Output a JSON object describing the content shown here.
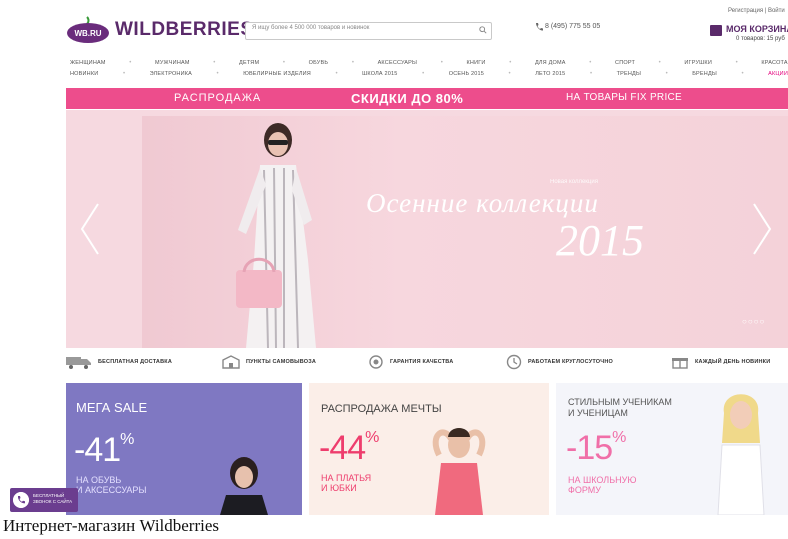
{
  "header": {
    "logo_badge": "WB.RU",
    "logo_text": "WILDBERRIES",
    "search_placeholder": "Я ищу более 4 500 000 товаров и новинок",
    "phone": "8 (495) 775 55 05",
    "top_links": "Регистрация | Войти",
    "cart_label": "МОЯ КОРЗИНА",
    "cart_summary": "0 товаров: 15 руб"
  },
  "nav": {
    "row1": [
      "ЖЕНЩИНАМ",
      "МУЖЧИНАМ",
      "ДЕТЯМ",
      "ОБУВЬ",
      "АКСЕССУАРЫ",
      "КНИГИ",
      "ДЛЯ ДОМА",
      "СПОРТ",
      "ИГРУШКИ",
      "КРАСОТА"
    ],
    "row2": [
      "НОВИНКИ",
      "ЭЛЕКТРОНИКА",
      "ЮВЕЛИРНЫЕ ИЗДЕЛИЯ",
      "ШКОЛА 2015",
      "ОСЕНЬ 2015",
      "ЛЕТО 2015",
      "ТРЕНДЫ",
      "БРЕНДЫ",
      "АКЦИИ"
    ]
  },
  "promo": {
    "left": "РАСПРОДАЖА",
    "center": "СКИДКИ ДО 80%",
    "right": "НА ТОВАРЫ FIX PRICE"
  },
  "banner": {
    "caption": "Новая коллекция",
    "title": "Осенние коллекции",
    "year": "2015"
  },
  "features": [
    {
      "label": "БЕСПЛАТНАЯ ДОСТАВКА",
      "icon": "truck-icon"
    },
    {
      "label": "ПУНКТЫ САМОВЫВОЗА",
      "icon": "store-icon"
    },
    {
      "label": "ГАРАНТИЯ КАЧЕСТВА",
      "icon": "quality-icon"
    },
    {
      "label": "РАБОТАЕМ КРУГЛОСУТОЧНО",
      "icon": "clock-icon"
    },
    {
      "label": "КАЖДЫЙ ДЕНЬ НОВИНКИ",
      "icon": "gift-icon"
    }
  ],
  "tiles": [
    {
      "head": "МЕГА SALE",
      "big": "-41",
      "pct": "%",
      "sub1": "НА ОБУВЬ",
      "sub2": "И АКСЕССУАРЫ"
    },
    {
      "head": "РАСПРОДАЖА МЕЧТЫ",
      "big": "-44",
      "pct": "%",
      "sub1": "НА ПЛАТЬЯ",
      "sub2": "И ЮБКИ"
    },
    {
      "head1": "СТИЛЬНЫМ УЧЕНИКАМ",
      "head2": "И УЧЕНИЦАМ",
      "big": "-15",
      "pct": "%",
      "sub1": "НА ШКОЛЬНУЮ",
      "sub2": "ФОРМУ"
    }
  ],
  "callback": {
    "line1": "БЕСПЛАТНЫЙ",
    "line2": "ЗВОНОК С САЙТА"
  },
  "caption": "Интернет-магазин Wildberries",
  "colors": {
    "brand": "#5a2a6a",
    "promo": "#ed4d8c",
    "accent": "#e4007c",
    "tile1": "#7f78c2"
  }
}
